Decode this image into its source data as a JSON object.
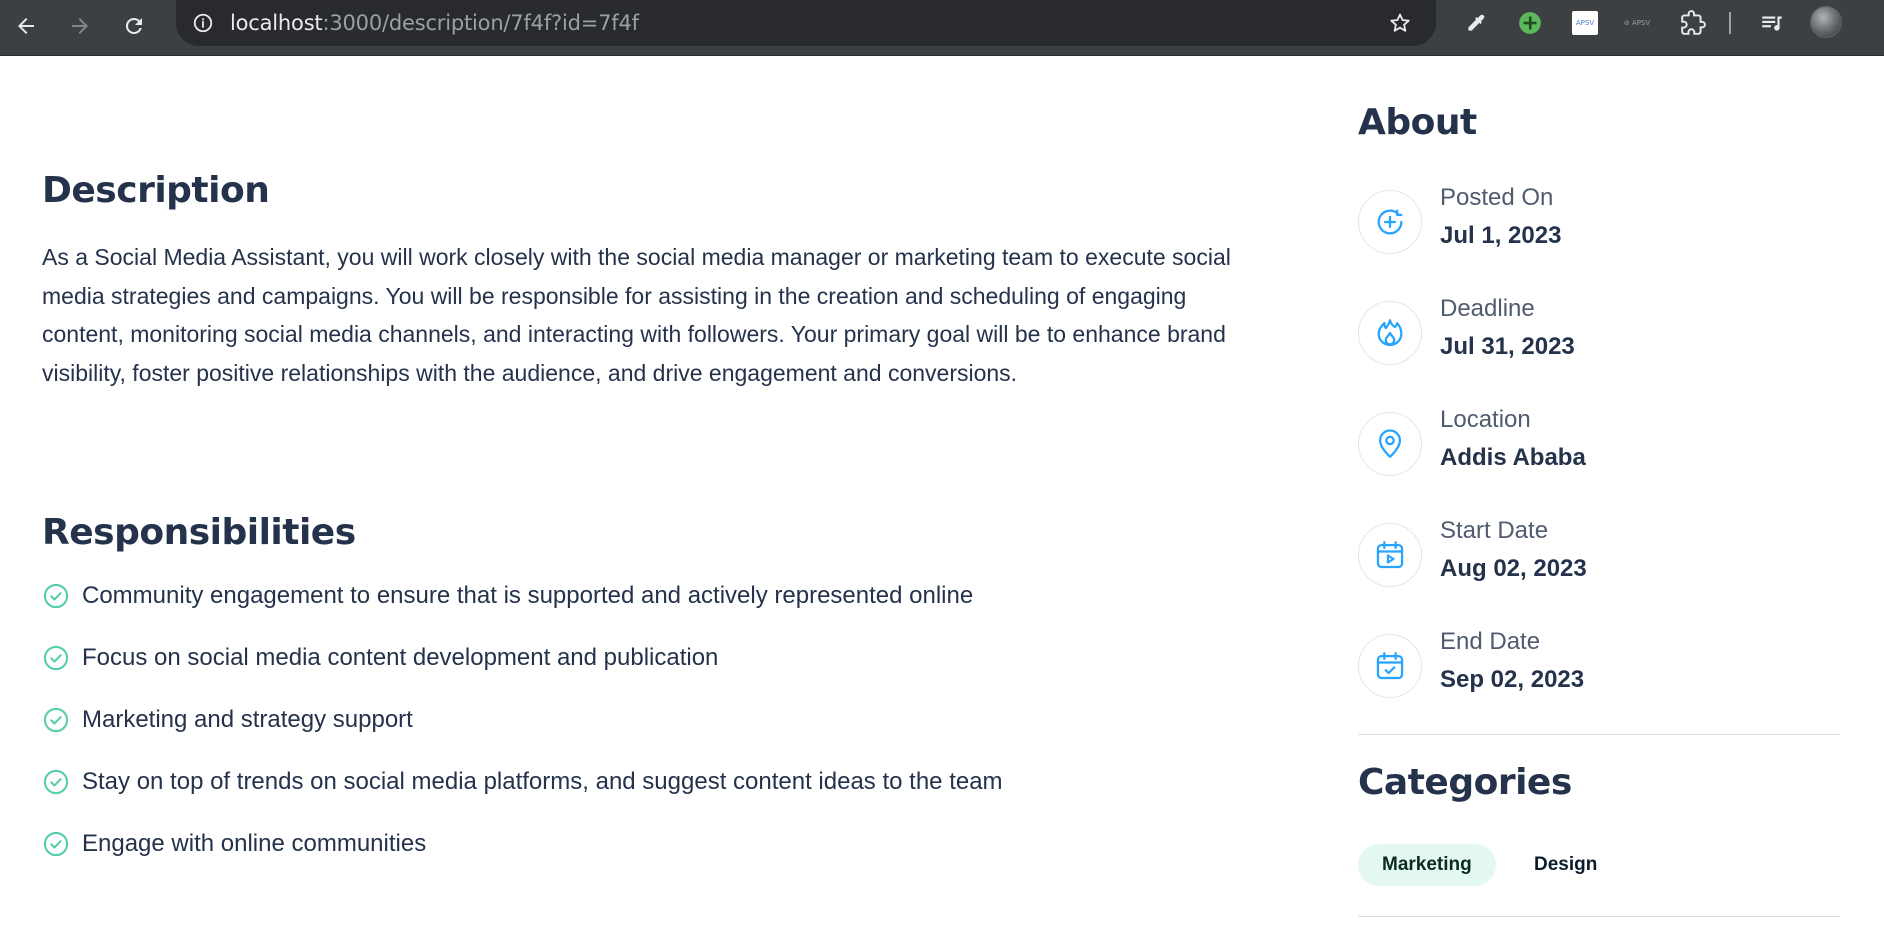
{
  "browser": {
    "url_host": "localhost",
    "url_path": ":3000/description/7f4f?id=7f4f",
    "ext_apsv_label": "APSV",
    "ext_gray_label": "⊘ APSV"
  },
  "description": {
    "heading": "Description",
    "body": "As a Social Media Assistant, you will work closely with the social media manager or marketing team to execute social media strategies and campaigns. You will be responsible for assisting in the creation and scheduling of engaging content, monitoring social media channels, and interacting with followers. Your primary goal will be to enhance brand visibility, foster positive relationships with the audience, and drive engagement and conversions."
  },
  "responsibilities": {
    "heading": "Responsibilities",
    "items": [
      "Community engagement to ensure that is supported and actively represented online",
      "Focus on social media content development and publication",
      "Marketing and strategy support",
      "Stay on top of trends on social media platforms, and suggest content ideas to the team",
      "Engage with online communities"
    ]
  },
  "about": {
    "heading": "About",
    "items": [
      {
        "label": "Posted On",
        "value": "Jul 1, 2023",
        "icon": "plus-circle-icon"
      },
      {
        "label": "Deadline",
        "value": "Jul 31, 2023",
        "icon": "fire-icon"
      },
      {
        "label": "Location",
        "value": "Addis Ababa",
        "icon": "location-pin-icon"
      },
      {
        "label": "Start Date",
        "value": "Aug 02, 2023",
        "icon": "calendar-play-icon"
      },
      {
        "label": "End Date",
        "value": "Sep 02, 2023",
        "icon": "calendar-check-icon"
      }
    ]
  },
  "categories": {
    "heading": "Categories",
    "tags": [
      "Marketing",
      "Design"
    ]
  },
  "colors": {
    "heading": "#25324b",
    "accent_blue": "#26a4ff",
    "check_green": "#56cdad",
    "tag_bg": "#e3f8ef"
  }
}
